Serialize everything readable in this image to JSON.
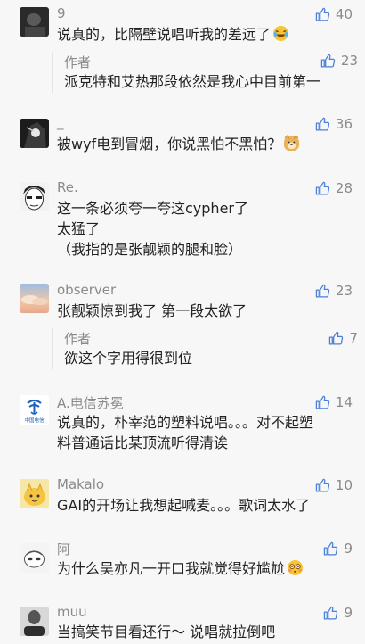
{
  "colors": {
    "background": "#f7f7f7",
    "text": "#222222",
    "meta": "#8a8a8a",
    "like_icon": "#4a7fd6",
    "reply_border": "#e4e4e4"
  },
  "comments": [
    {
      "username": "9",
      "likes": "40",
      "avatar": "dark-photo-avatar",
      "lines": [
        "说真的，比隔壁说唱听我的差远了"
      ],
      "emoji": "laughing-crying-emoji",
      "reply": {
        "author": "作者",
        "text": "派克特和艾热那段依然是我心中目前第一",
        "likes": "23"
      }
    },
    {
      "username": "_",
      "likes": "36",
      "avatar": "anime-dark-avatar",
      "lines": [
        "被wyf电到冒烟，你说黑怕不黑怕？"
      ],
      "emoji": "doge-emoji"
    },
    {
      "username": "Re.",
      "likes": "28",
      "avatar": "manga-face-avatar",
      "lines": [
        "这一条必须夸一夸这cypher了",
        "太猛了",
        "（我指的是张靓颖的腿和脸）"
      ]
    },
    {
      "username": "observer",
      "likes": "23",
      "avatar": "sunset-cloud-avatar",
      "lines": [
        "张靓颖惊到我了 第一段太欲了"
      ],
      "reply": {
        "author": "作者",
        "text": "欲这个字用得很到位",
        "likes": "7"
      }
    },
    {
      "username": "A.电信苏冕",
      "likes": "14",
      "avatar": "china-telecom-logo-avatar",
      "avatar_caption": "中国电信",
      "lines": [
        "说真的，朴宰范的塑料说唱。。。对不起塑",
        "料普通话比某顶流听得清诶"
      ]
    },
    {
      "username": "Makalo",
      "likes": "10",
      "avatar": "yellow-cartoon-avatar",
      "lines": [
        "GAI的开场让我想起喊麦。。。歌词太水了"
      ]
    },
    {
      "username": "阿",
      "likes": "9",
      "avatar": "sketch-face-avatar",
      "lines": [
        "为什么吴亦凡一开口我就觉得好尴尬"
      ],
      "emoji": "flushed-emoji"
    },
    {
      "username": "muu",
      "likes": "9",
      "avatar": "bw-portrait-avatar",
      "lines": [
        "当搞笑节目看还行～ 说唱就拉倒吧"
      ]
    }
  ]
}
